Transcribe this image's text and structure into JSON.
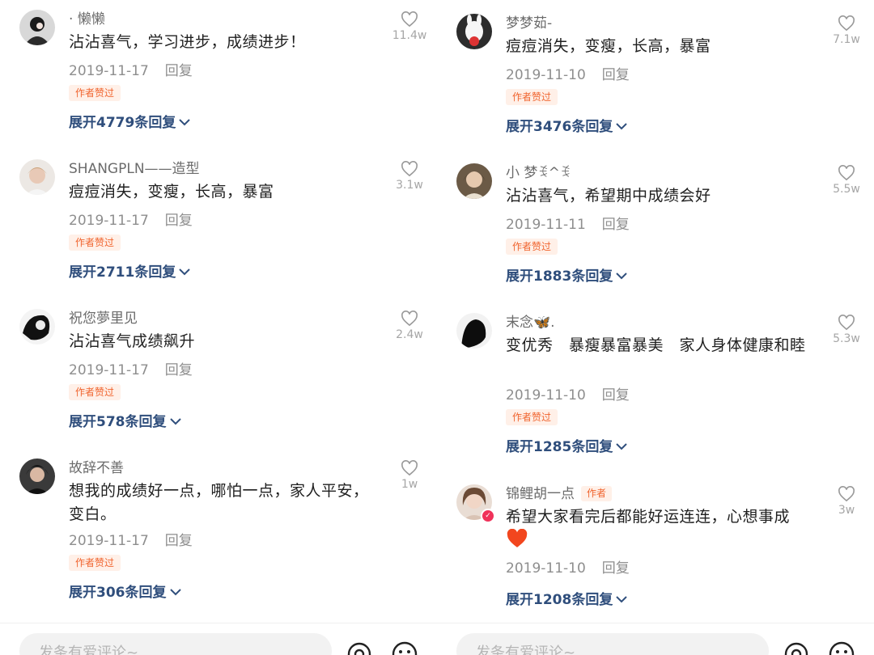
{
  "colors": {
    "link": "#2f4e7c",
    "author_tag": "#f0642e",
    "author_tag_bg": "#fff0e8",
    "meta": "#8e8e8e"
  },
  "reply_label": "回复",
  "liked_by_author": "作者赞过",
  "author_label": "作者",
  "input_placeholder": "发条有爱评论~",
  "left": [
    {
      "user": "· 懒懒",
      "text": "沾沾喜气，学习进步，成绩进步！",
      "date": "2019-11-17",
      "likes": "11.4w",
      "expand": "展开4779条回复"
    },
    {
      "user": "SHANGPLN——造型",
      "text": "痘痘消失，变瘦，长高，暴富",
      "date": "2019-11-17",
      "likes": "3.1w",
      "expand": "展开2711条回复"
    },
    {
      "user": "祝您夢里见",
      "text": "沾沾喜气成绩飙升",
      "date": "2019-11-17",
      "likes": "2.4w",
      "expand": "展开578条回复"
    },
    {
      "user": "故辞不善",
      "text": "想我的成绩好一点，哪怕一点，家人平安，变白。",
      "date": "2019-11-17",
      "likes": "1w",
      "expand": "展开306条回复"
    }
  ],
  "right": [
    {
      "user": "梦梦茹-",
      "text": "痘痘消失，变瘦，长高，暴富",
      "date": "2019-11-10",
      "likes": "7.1w",
      "expand": "展开3476条回复"
    },
    {
      "user": "小 梦ꉂ^ꉂ",
      "text": "沾沾喜气，希望期中成绩会好",
      "date": "2019-11-11",
      "likes": "5.5w",
      "expand": "展开1883条回复"
    },
    {
      "user": "末念🦋.",
      "text": "变优秀　暴瘦暴富暴美　家人身体健康和睦",
      "date": "2019-11-10",
      "likes": "5.3w",
      "expand": "展开1285条回复"
    },
    {
      "user": "锦鲤胡一点",
      "text": "希望大家看完后都能好运连连，心想事成",
      "date": "2019-11-10",
      "likes": "3w",
      "expand": "展开1208条回复"
    }
  ]
}
